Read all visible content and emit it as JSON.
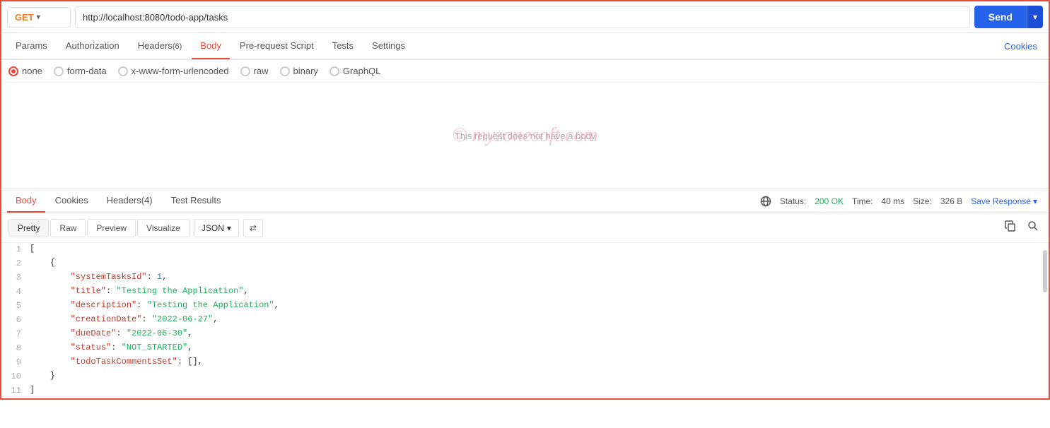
{
  "topbar": {
    "method": "GET",
    "method_chevron": "▾",
    "url": "http://localhost:8080/todo-app/tasks",
    "send_label": "Send",
    "send_chevron": "▾"
  },
  "request_tabs": [
    {
      "id": "params",
      "label": "Params",
      "active": false
    },
    {
      "id": "authorization",
      "label": "Authorization",
      "active": false
    },
    {
      "id": "headers",
      "label": "Headers",
      "badge": "(6)",
      "active": false
    },
    {
      "id": "body",
      "label": "Body",
      "active": true
    },
    {
      "id": "pre_request_script",
      "label": "Pre-request Script",
      "active": false
    },
    {
      "id": "tests",
      "label": "Tests",
      "active": false
    },
    {
      "id": "settings",
      "label": "Settings",
      "active": false
    }
  ],
  "cookies_link": "Cookies",
  "body_types": [
    {
      "id": "none",
      "label": "none",
      "active": true
    },
    {
      "id": "form-data",
      "label": "form-data",
      "active": false
    },
    {
      "id": "x-www-form-urlencoded",
      "label": "x-www-form-urlencoded",
      "active": false
    },
    {
      "id": "raw",
      "label": "raw",
      "active": false
    },
    {
      "id": "binary",
      "label": "binary",
      "active": false
    },
    {
      "id": "graphql",
      "label": "GraphQL",
      "active": false
    }
  ],
  "body_empty_text": "This request does not have a body",
  "watermark": "© myzonesoft.com",
  "response_tabs": [
    {
      "id": "body",
      "label": "Body",
      "active": true
    },
    {
      "id": "cookies",
      "label": "Cookies",
      "active": false
    },
    {
      "id": "headers",
      "label": "Headers",
      "badge": "(4)",
      "active": false
    },
    {
      "id": "test_results",
      "label": "Test Results",
      "active": false
    }
  ],
  "response_meta": {
    "status": "Status:",
    "status_value": "200 OK",
    "time_label": "Time:",
    "time_value": "40 ms",
    "size_label": "Size:",
    "size_value": "326 B",
    "save_response": "Save Response",
    "save_chevron": "▾"
  },
  "format_buttons": [
    {
      "id": "pretty",
      "label": "Pretty",
      "active": true
    },
    {
      "id": "raw",
      "label": "Raw",
      "active": false
    },
    {
      "id": "preview",
      "label": "Preview",
      "active": false
    },
    {
      "id": "visualize",
      "label": "Visualize",
      "active": false
    }
  ],
  "format_select": {
    "value": "JSON",
    "chevron": "▾"
  },
  "json_response": [
    {
      "line": 1,
      "content": "[",
      "type": "bracket"
    },
    {
      "line": 2,
      "content": "    {",
      "type": "bracket"
    },
    {
      "line": 3,
      "key": "\"systemTasksId\"",
      "separator": ": ",
      "value": "1",
      "value_type": "number"
    },
    {
      "line": 4,
      "key": "\"title\"",
      "separator": ": ",
      "value": "\"Testing the Application\"",
      "value_type": "string"
    },
    {
      "line": 5,
      "key": "\"description\"",
      "separator": ": ",
      "value": "\"Testing the Application\"",
      "value_type": "string"
    },
    {
      "line": 6,
      "key": "\"creationDate\"",
      "separator": ": ",
      "value": "\"2022-06-27\"",
      "value_type": "string"
    },
    {
      "line": 7,
      "key": "\"dueDate\"",
      "separator": ": ",
      "value": "\"2022-06-30\"",
      "value_type": "string"
    },
    {
      "line": 8,
      "key": "\"status\"",
      "separator": ": ",
      "value": "\"NOT_STARTED\"",
      "value_type": "string"
    },
    {
      "line": 9,
      "key": "\"todoTaskCommentsSet\"",
      "separator": ": ",
      "value": "[]",
      "value_type": "bracket"
    },
    {
      "line": 10,
      "content": "    }",
      "type": "bracket"
    },
    {
      "line": 11,
      "content": "]",
      "type": "bracket"
    }
  ]
}
